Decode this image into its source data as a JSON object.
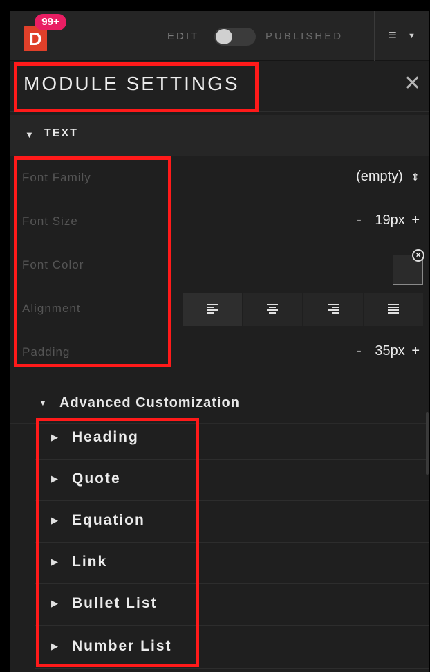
{
  "topbar": {
    "logo_letter": "D",
    "notification_count": "99+",
    "edit_label": "EDIT",
    "published_label": "PUBLISHED",
    "menu_icon": "hamburger-menu-icon",
    "toggle_state": "off"
  },
  "panel": {
    "title": "MODULE SETTINGS",
    "close_icon": "close-icon"
  },
  "text_section": {
    "title": "TEXT",
    "font_family": {
      "label": "Font Family",
      "value": "(empty)",
      "icon": "sort-arrows-icon"
    },
    "font_size": {
      "label": "Font Size",
      "minus": "-",
      "value": "19px",
      "plus": "+"
    },
    "font_color": {
      "label": "Font Color",
      "swatch_color": "#2b2b2b"
    },
    "alignment": {
      "label": "Alignment",
      "options": [
        "align-left",
        "align-center",
        "align-right",
        "align-justify"
      ],
      "selected": "align-left"
    },
    "padding": {
      "label": "Padding",
      "minus": "-",
      "value": "35px",
      "plus": "+"
    }
  },
  "advanced": {
    "title": "Advanced Customization",
    "items": [
      {
        "label": "Heading"
      },
      {
        "label": "Quote"
      },
      {
        "label": "Equation"
      },
      {
        "label": "Link"
      },
      {
        "label": "Bullet List"
      },
      {
        "label": "Number List"
      }
    ]
  },
  "colors": {
    "background": "#1f1f1f",
    "logo": "#e0402a",
    "badge": "#e91e63",
    "annotation": "#ff1a1a"
  }
}
